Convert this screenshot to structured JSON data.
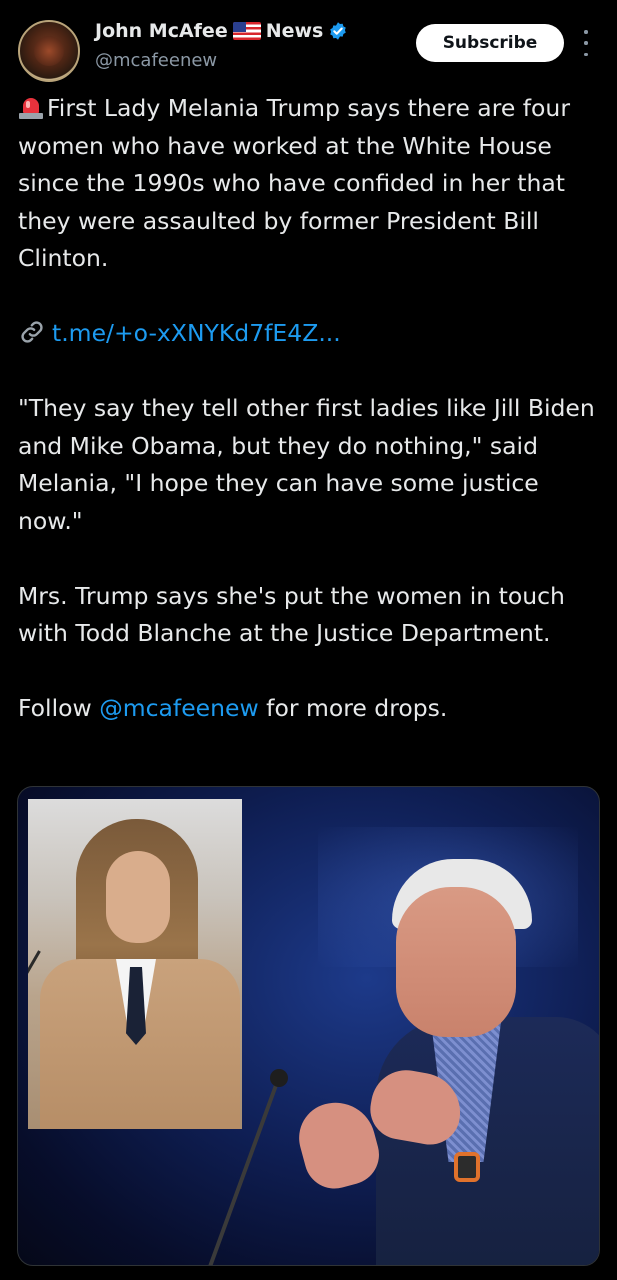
{
  "post": {
    "author": {
      "display_name": "John McAfee",
      "flag_icon": "us-flag-icon",
      "name_suffix": "News",
      "verified_icon": "verified-badge-icon",
      "verified_color": "#1d9bf0",
      "handle": "@mcafeenew"
    },
    "subscribe_label": "Subscribe",
    "more_icon": "more-vertical-icon",
    "body": {
      "siren_icon": "rotating-light-icon",
      "headline": "First Lady Melania Trump says there are four women who have worked at the White House since the 1990s who have confided in her that they were assaulted by former President Bill Clinton.",
      "link_icon": "link-icon",
      "link_text": "t.me/+o-xXNYKd7fE4Z...",
      "quote": "\"They say they tell other first ladies like Jill Biden and Mike Obama, but they do nothing,\" said Melania, \"I hope they can have some justice now.\"",
      "paragraph_3": "Mrs. Trump says she's put the women in touch with Todd Blanche at the Justice Department.",
      "follow_prefix": "Follow",
      "follow_mention": "@mcafeenew",
      "follow_suffix": "for more drops."
    },
    "media": {
      "description_icon": "photo-icon"
    }
  },
  "colors": {
    "background": "#000000",
    "text": "#e7e9ea",
    "secondary_text": "#8b98a5",
    "link": "#1d9bf0",
    "button_bg": "#ffffff",
    "button_text": "#0f1419"
  }
}
